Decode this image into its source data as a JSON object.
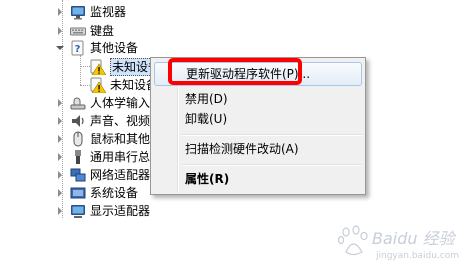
{
  "tree": {
    "items": [
      {
        "label": "监视器",
        "icon": "monitor-icon",
        "expanded": false
      },
      {
        "label": "键盘",
        "icon": "keyboard-icon",
        "expanded": false
      },
      {
        "label": "其他设备",
        "icon": "unknown-device-icon",
        "expanded": true
      },
      {
        "label": "未知设备",
        "icon": "warning-device-icon",
        "child": true
      },
      {
        "label": "未知设备",
        "icon": "warning-device-icon",
        "child": true
      },
      {
        "label": "人体学输入",
        "icon": "hid-icon",
        "expanded": false
      },
      {
        "label": "声音、视频",
        "icon": "speaker-icon",
        "expanded": false
      },
      {
        "label": "鼠标和其他",
        "icon": "mouse-icon",
        "expanded": false
      },
      {
        "label": "通用串行总",
        "icon": "usb-icon",
        "expanded": false
      },
      {
        "label": "网络适配器",
        "icon": "network-icon",
        "expanded": false
      },
      {
        "label": "系统设备",
        "icon": "system-icon",
        "expanded": false
      },
      {
        "label": "显示适配器",
        "icon": "display-adapter-icon",
        "expanded": false
      }
    ]
  },
  "context_menu": {
    "items": [
      {
        "label": "更新驱动程序软件(P)...",
        "highlighted": true
      },
      {
        "label": "禁用(D)"
      },
      {
        "label": "卸载(U)"
      },
      {
        "label": "扫描检测硬件改动(A)"
      },
      {
        "label": "属性(R)",
        "bold": true
      }
    ]
  },
  "watermark": {
    "text": "Baidu 经验",
    "sub": "jingyan.baidu.com"
  },
  "colors": {
    "highlight_border": "#ff0000",
    "menu_bg": "#f0f0f0",
    "selection": "#a8c5ea"
  }
}
